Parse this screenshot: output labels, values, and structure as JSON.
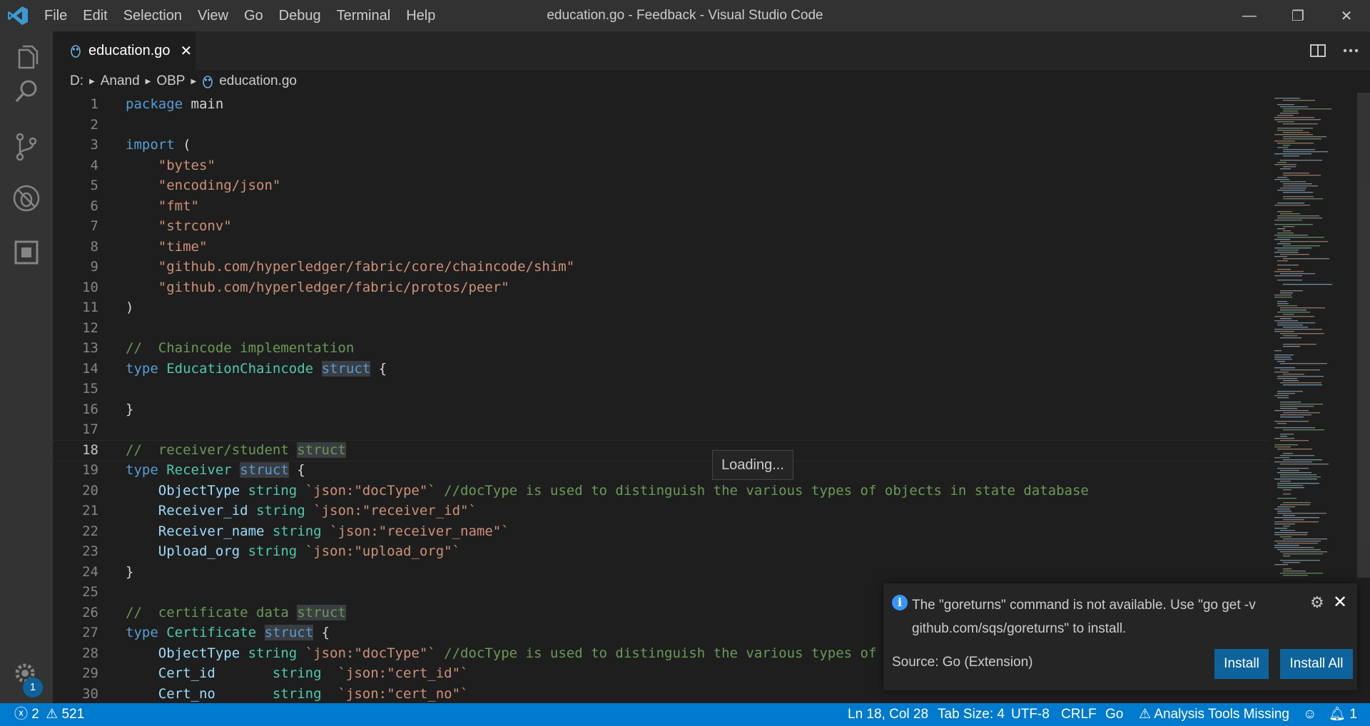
{
  "titlebar": {
    "menu": [
      "File",
      "Edit",
      "Selection",
      "View",
      "Go",
      "Debug",
      "Terminal",
      "Help"
    ],
    "title": "education.go - Feedback - Visual Studio Code",
    "controls": {
      "minimize": "—",
      "restore": "❐",
      "close": "✕"
    }
  },
  "activitybar": {
    "badge": "1"
  },
  "tab": {
    "label": "education.go",
    "close": "✕"
  },
  "breadcrumb": [
    "D:",
    "Anand",
    "OBP",
    "education.go"
  ],
  "editor": {
    "active_line": 18,
    "lines": [
      {
        "n": "1",
        "tokens": [
          {
            "t": "package",
            "c": "kw"
          },
          {
            "t": " main",
            "c": ""
          }
        ]
      },
      {
        "n": "2",
        "tokens": []
      },
      {
        "n": "3",
        "tokens": [
          {
            "t": "import",
            "c": "kw"
          },
          {
            "t": " (",
            "c": ""
          }
        ]
      },
      {
        "n": "4",
        "tokens": [
          {
            "t": "    ",
            "c": ""
          },
          {
            "t": "\"bytes\"",
            "c": "str"
          }
        ]
      },
      {
        "n": "5",
        "tokens": [
          {
            "t": "    ",
            "c": ""
          },
          {
            "t": "\"encoding/json\"",
            "c": "str"
          }
        ]
      },
      {
        "n": "6",
        "tokens": [
          {
            "t": "    ",
            "c": ""
          },
          {
            "t": "\"fmt\"",
            "c": "str"
          }
        ]
      },
      {
        "n": "7",
        "tokens": [
          {
            "t": "    ",
            "c": ""
          },
          {
            "t": "\"strconv\"",
            "c": "str"
          }
        ]
      },
      {
        "n": "8",
        "tokens": [
          {
            "t": "    ",
            "c": ""
          },
          {
            "t": "\"time\"",
            "c": "str"
          }
        ]
      },
      {
        "n": "9",
        "tokens": [
          {
            "t": "    ",
            "c": ""
          },
          {
            "t": "\"github.com/hyperledger/fabric/core/chaincode/shim\"",
            "c": "str"
          }
        ]
      },
      {
        "n": "10",
        "tokens": [
          {
            "t": "    ",
            "c": ""
          },
          {
            "t": "\"github.com/hyperledger/fabric/protos/peer\"",
            "c": "str"
          }
        ]
      },
      {
        "n": "11",
        "tokens": [
          {
            "t": ")",
            "c": ""
          }
        ]
      },
      {
        "n": "12",
        "tokens": []
      },
      {
        "n": "13",
        "tokens": [
          {
            "t": "//  Chaincode implementation",
            "c": "cm"
          }
        ]
      },
      {
        "n": "14",
        "tokens": [
          {
            "t": "type",
            "c": "kw"
          },
          {
            "t": " ",
            "c": ""
          },
          {
            "t": "EducationChaincode",
            "c": "ty"
          },
          {
            "t": " ",
            "c": ""
          },
          {
            "t": "struct",
            "c": "kw hl"
          },
          {
            "t": " {",
            "c": ""
          }
        ]
      },
      {
        "n": "15",
        "tokens": []
      },
      {
        "n": "16",
        "tokens": [
          {
            "t": "}",
            "c": ""
          }
        ]
      },
      {
        "n": "17",
        "tokens": []
      },
      {
        "n": "18",
        "tokens": [
          {
            "t": "//  receiver/student ",
            "c": "cm"
          },
          {
            "t": "struct",
            "c": "cm hl"
          }
        ]
      },
      {
        "n": "19",
        "tokens": [
          {
            "t": "type",
            "c": "kw"
          },
          {
            "t": " ",
            "c": ""
          },
          {
            "t": "Receiver",
            "c": "ty"
          },
          {
            "t": " ",
            "c": ""
          },
          {
            "t": "struct",
            "c": "kw hl"
          },
          {
            "t": " {",
            "c": ""
          }
        ]
      },
      {
        "n": "20",
        "tokens": [
          {
            "t": "    ",
            "c": ""
          },
          {
            "t": "ObjectType",
            "c": "fld"
          },
          {
            "t": " ",
            "c": ""
          },
          {
            "t": "string",
            "c": "ty"
          },
          {
            "t": " ",
            "c": ""
          },
          {
            "t": "`json:\"docType\"`",
            "c": "str"
          },
          {
            "t": " //docType is used to distinguish the various types of objects in state database",
            "c": "cm"
          }
        ]
      },
      {
        "n": "21",
        "tokens": [
          {
            "t": "    ",
            "c": ""
          },
          {
            "t": "Receiver_id",
            "c": "fld"
          },
          {
            "t": " ",
            "c": ""
          },
          {
            "t": "string",
            "c": "ty"
          },
          {
            "t": " ",
            "c": ""
          },
          {
            "t": "`json:\"receiver_id\"`",
            "c": "str"
          }
        ]
      },
      {
        "n": "22",
        "tokens": [
          {
            "t": "    ",
            "c": ""
          },
          {
            "t": "Receiver_name",
            "c": "fld"
          },
          {
            "t": " ",
            "c": ""
          },
          {
            "t": "string",
            "c": "ty"
          },
          {
            "t": " ",
            "c": ""
          },
          {
            "t": "`json:\"receiver_name\"`",
            "c": "str"
          }
        ]
      },
      {
        "n": "23",
        "tokens": [
          {
            "t": "    ",
            "c": ""
          },
          {
            "t": "Upload_org",
            "c": "fld"
          },
          {
            "t": " ",
            "c": ""
          },
          {
            "t": "string",
            "c": "ty"
          },
          {
            "t": " ",
            "c": ""
          },
          {
            "t": "`json:\"upload_org\"`",
            "c": "str"
          }
        ]
      },
      {
        "n": "24",
        "tokens": [
          {
            "t": "}",
            "c": ""
          }
        ]
      },
      {
        "n": "25",
        "tokens": []
      },
      {
        "n": "26",
        "tokens": [
          {
            "t": "//  certificate data ",
            "c": "cm"
          },
          {
            "t": "struct",
            "c": "cm hl"
          }
        ]
      },
      {
        "n": "27",
        "tokens": [
          {
            "t": "type",
            "c": "kw"
          },
          {
            "t": " ",
            "c": ""
          },
          {
            "t": "Certificate",
            "c": "ty"
          },
          {
            "t": " ",
            "c": ""
          },
          {
            "t": "struct",
            "c": "kw hl"
          },
          {
            "t": " {",
            "c": ""
          }
        ]
      },
      {
        "n": "28",
        "tokens": [
          {
            "t": "    ",
            "c": ""
          },
          {
            "t": "ObjectType",
            "c": "fld"
          },
          {
            "t": " ",
            "c": ""
          },
          {
            "t": "string",
            "c": "ty"
          },
          {
            "t": " ",
            "c": ""
          },
          {
            "t": "`json:\"docType\"`",
            "c": "str"
          },
          {
            "t": " //docType is used to distinguish the various types of",
            "c": "cm"
          }
        ]
      },
      {
        "n": "29",
        "tokens": [
          {
            "t": "    ",
            "c": ""
          },
          {
            "t": "Cert_id",
            "c": "fld"
          },
          {
            "t": "       ",
            "c": ""
          },
          {
            "t": "string",
            "c": "ty"
          },
          {
            "t": "  ",
            "c": ""
          },
          {
            "t": "`json:\"cert_id\"`",
            "c": "str"
          }
        ]
      },
      {
        "n": "30",
        "tokens": [
          {
            "t": "    ",
            "c": ""
          },
          {
            "t": "Cert_no",
            "c": "fld"
          },
          {
            "t": "       ",
            "c": ""
          },
          {
            "t": "string",
            "c": "ty"
          },
          {
            "t": "  ",
            "c": ""
          },
          {
            "t": "`json:\"cert_no\"`",
            "c": "str"
          }
        ]
      }
    ],
    "hover": "Loading..."
  },
  "notification": {
    "message": "The \"goreturns\" command is not available. Use \"go get -v github.com/sqs/goreturns\" to install.",
    "source": "Source: Go (Extension)",
    "buttons": [
      "Install",
      "Install All"
    ]
  },
  "statusbar": {
    "errors": "2",
    "warnings": "521",
    "position": "Ln 18, Col 28",
    "tab_size": "Tab Size: 4",
    "encoding": "UTF-8",
    "eol": "CRLF",
    "language": "Go",
    "analysis": "Analysis Tools Missing",
    "notifications": "1"
  },
  "colors": {
    "keyword": "#569cd6",
    "type": "#4ec9b0",
    "string": "#ce9178",
    "comment": "#6a9955",
    "field": "#9cdcfe",
    "statusbar": "#007acc",
    "button": "#0e639c"
  }
}
